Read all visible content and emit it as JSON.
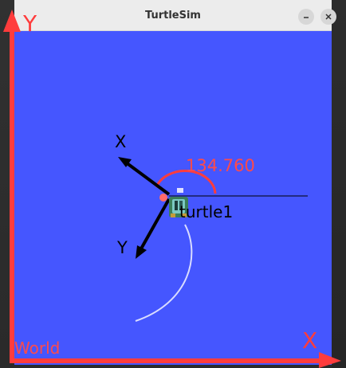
{
  "window": {
    "title": "TurtleSim",
    "minimize_label": "–",
    "close_label": "×"
  },
  "canvas": {
    "background": "#4556ff"
  },
  "world_axes": {
    "x_label": "X",
    "y_label": "Y",
    "frame_label": "World",
    "color": "#ff3c3c"
  },
  "turtle": {
    "name": "turtle1",
    "heading_deg": "134.760",
    "local_x_label": "X",
    "local_y_label": "Y",
    "trail_color": "#d9dcff"
  },
  "icons": {
    "minimize": "minimize-icon",
    "close": "close-icon",
    "turtle": "turtle-icon"
  }
}
